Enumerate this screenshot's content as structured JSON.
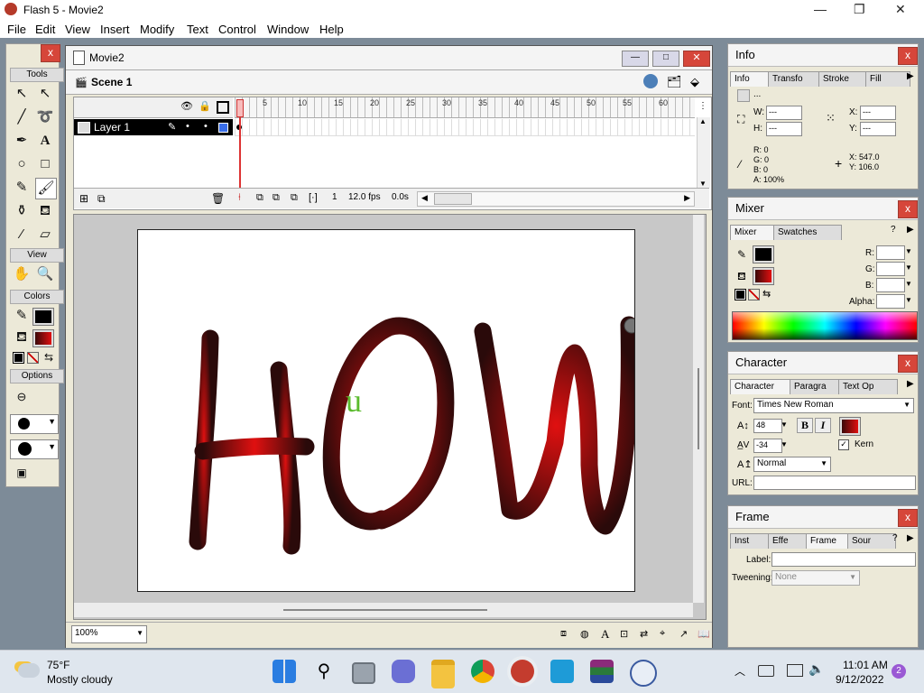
{
  "window": {
    "title": "Flash 5 - Movie2"
  },
  "menu": [
    "File",
    "Edit",
    "View",
    "Insert",
    "Modify",
    "Text",
    "Control",
    "Window",
    "Help"
  ],
  "toolbox": {
    "title": "Tools",
    "view_label": "View",
    "colors_label": "Colors",
    "options_label": "Options",
    "stroke_color": "#000000",
    "fill_color": "#cc0000"
  },
  "movie_window": {
    "title": "Movie2",
    "scene": "Scene 1",
    "layer": "Layer 1",
    "frame_numbers": [
      "5",
      "10",
      "15",
      "20",
      "25",
      "30",
      "35",
      "40",
      "45",
      "50",
      "55",
      "60"
    ],
    "current_frame": "1",
    "fps": "12.0 fps",
    "time": "0.0s",
    "zoom": "100%"
  },
  "stage": {
    "drawing_text": "HOW",
    "green_letter": "u",
    "stroke_dark": "#2a0a0a",
    "stroke_bright": "#e01010"
  },
  "info_panel": {
    "title": "Info",
    "tabs": [
      "Info",
      "Transfo",
      "Stroke",
      "Fill"
    ],
    "dash": "...",
    "w_label": "W:",
    "h_label": "H:",
    "x_label": "X:",
    "y_label": "Y:",
    "w_value": "---",
    "h_value": "---",
    "x_value": "---",
    "y_value": "---",
    "r": "R: 0",
    "g": "G: 0",
    "b": "B: 0",
    "a": "A: 100%",
    "cursor_x": "X:   547.0",
    "cursor_y": "Y:   106.0"
  },
  "mixer_panel": {
    "title": "Mixer",
    "tabs": [
      "Mixer",
      "Swatches"
    ],
    "r_label": "R:",
    "g_label": "G:",
    "b_label": "B:",
    "alpha_label": "Alpha:"
  },
  "character_panel": {
    "title": "Character",
    "tabs": [
      "Character",
      "Paragra",
      "Text Op"
    ],
    "font_label": "Font:",
    "font": "Times New Roman",
    "size": "48",
    "tracking": "-34",
    "bold": "B",
    "italic": "I",
    "kern_label": "Kern",
    "baseline": "Normal",
    "url_label": "URL:"
  },
  "frame_panel": {
    "title": "Frame",
    "tabs": [
      "Inst",
      "Effe",
      "Frame",
      "Sour"
    ],
    "label_label": "Label:",
    "tweening_label": "Tweening:",
    "tweening_value": "None"
  },
  "taskbar": {
    "temperature": "75°F",
    "weather": "Mostly cloudy",
    "time": "11:01 AM",
    "date": "9/12/2022",
    "notifications": "2"
  }
}
